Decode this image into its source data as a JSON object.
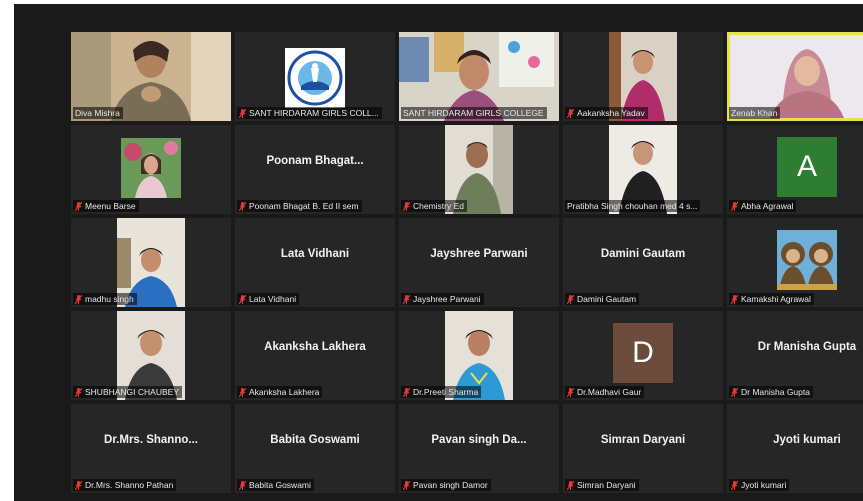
{
  "tiles": [
    {
      "label": "Diva Mishra",
      "muted": false
    },
    {
      "label": "SANT HIRDARAM GIRLS COLL...",
      "muted": true
    },
    {
      "label": "SANT HIRDARAM GIRLS COLLEGE",
      "muted": true
    },
    {
      "label": "Aakanksha Yadav",
      "muted": true
    },
    {
      "label": "Zenab Khan",
      "muted": false
    },
    {
      "label": "Meenu Barse",
      "muted": true
    },
    {
      "name": "Poonam  Bhagat...",
      "label": "Poonam Bhagat B. Ed II sem",
      "muted": true
    },
    {
      "label": "Chemistry Ed",
      "muted": true
    },
    {
      "label": "Pratibha Singh chouhan med 4 s...",
      "muted": true
    },
    {
      "label": "Abha Agrawal",
      "muted": true,
      "avatar": "A",
      "avatar_color": "#2e7d32"
    },
    {
      "label": "madhu singh",
      "muted": true
    },
    {
      "name": "Lata Vidhani",
      "label": "Lata Vidhani",
      "muted": true
    },
    {
      "name": "Jayshree Parwani",
      "label": "Jayshree Parwani",
      "muted": true
    },
    {
      "name": "Damini Gautam",
      "label": "Damini Gautam",
      "muted": true
    },
    {
      "label": "Kamakshi Agrawal",
      "muted": true
    },
    {
      "label": "SHUBHANGI CHAUBEY",
      "muted": true
    },
    {
      "name": "Akanksha Lakhera",
      "label": "Akanksha Lakhera",
      "muted": true
    },
    {
      "label": "Dr.Preeti Sharma",
      "muted": true
    },
    {
      "label": "Dr.Madhavi Gaur",
      "muted": true,
      "avatar": "D",
      "avatar_color": "#6d4b3a"
    },
    {
      "name": "Dr Manisha Gupta",
      "label": "Dr Manisha Gupta",
      "muted": true
    },
    {
      "name": "Dr.Mrs. Shanno...",
      "label": "Dr.Mrs. Shanno Pathan",
      "muted": true
    },
    {
      "name": "Babita Goswami",
      "label": "Babita Goswami",
      "muted": true
    },
    {
      "name": "Pavan singh Da...",
      "label": "Pavan singh Damor",
      "muted": true
    },
    {
      "name": "Simran Daryani",
      "label": "Simran Daryani",
      "muted": true
    },
    {
      "name": "Jyoti kumari",
      "label": "Jyoti kumari",
      "muted": true
    }
  ],
  "colors": {
    "active_speaker": "#e6e34a",
    "muted_mic": "#e53935",
    "tile_bg": "#262626"
  }
}
